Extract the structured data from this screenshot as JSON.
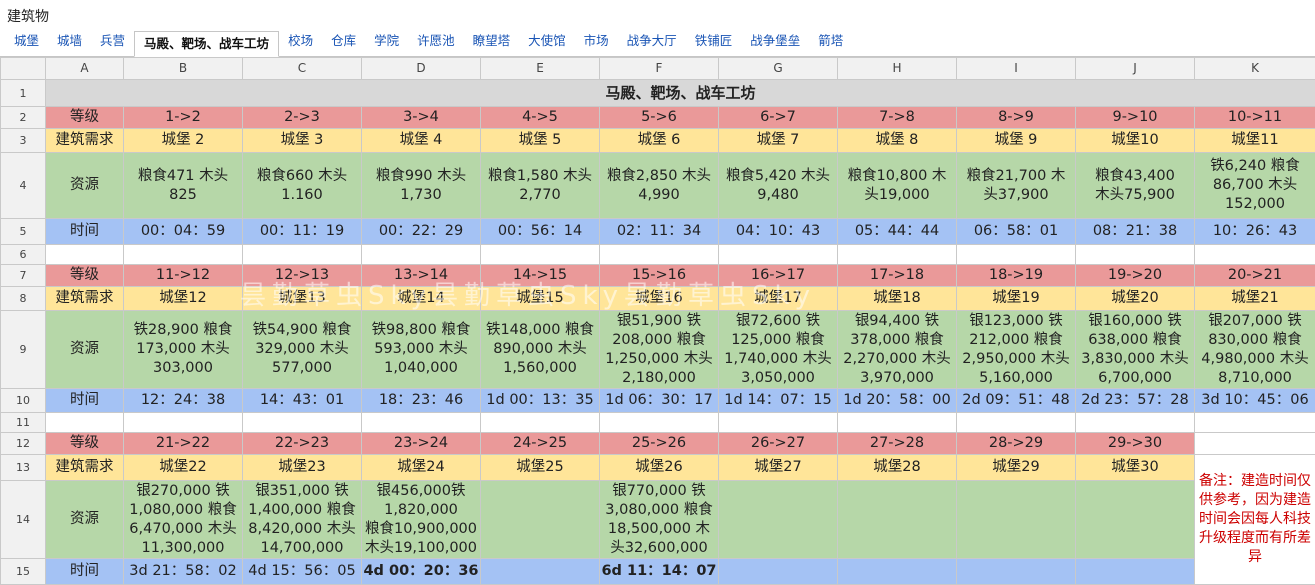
{
  "window": {
    "title": "建筑物"
  },
  "tabs": [
    {
      "label": "城堡"
    },
    {
      "label": "城墙"
    },
    {
      "label": "兵营"
    },
    {
      "label": "马殿、靶场、战车工坊",
      "active": true
    },
    {
      "label": "校场"
    },
    {
      "label": "仓库"
    },
    {
      "label": "学院"
    },
    {
      "label": "许愿池"
    },
    {
      "label": "瞭望塔"
    },
    {
      "label": "大使馆"
    },
    {
      "label": "市场"
    },
    {
      "label": "战争大厅"
    },
    {
      "label": "铁铺匠"
    },
    {
      "label": "战争堡垒"
    },
    {
      "label": "箭塔"
    }
  ],
  "columns": [
    "A",
    "B",
    "C",
    "D",
    "E",
    "F",
    "G",
    "H",
    "I",
    "J",
    "K"
  ],
  "row_numbers": [
    "1",
    "2",
    "3",
    "4",
    "5",
    "6",
    "7",
    "8",
    "9",
    "10",
    "11",
    "12",
    "13",
    "14",
    "15"
  ],
  "sheet_title": "马殿、靶场、战车工坊",
  "labels": {
    "level": "等级",
    "requirement": "建筑需求",
    "resource": "资源",
    "time": "时间"
  },
  "blocks": [
    {
      "levels": [
        "1->2",
        "2->3",
        "3->4",
        "4->5",
        "5->6",
        "6->7",
        "7->8",
        "8->9",
        "9->10",
        "10->11"
      ],
      "requirements": [
        "城堡 2",
        "城堡 3",
        "城堡 4",
        "城堡 5",
        "城堡 6",
        "城堡 7",
        "城堡 8",
        "城堡 9",
        "城堡10",
        "城堡11"
      ],
      "resources": [
        "粮食471 木头\n825",
        "粮食660 木头\n1.160",
        "粮食990 木头\n1,730",
        "粮食1,580 木头\n2,770",
        "粮食2,850 木头\n4,990",
        "粮食5,420 木头\n9,480",
        "粮食10,800 木\n头19,000",
        "粮食21,700 木\n头37,900",
        "粮食43,400\n木头75,900",
        "铁6,240 粮食\n86,700 木头\n152,000"
      ],
      "times": [
        "00：04：59",
        "00：11：19",
        "00：22：29",
        "00：56：14",
        "02：11：34",
        "04：10：43",
        "05：44：44",
        "06：58：01",
        "08：21：38",
        "10：26：43"
      ]
    },
    {
      "levels": [
        "11->12",
        "12->13",
        "13->14",
        "14->15",
        "15->16",
        "16->17",
        "17->18",
        "18->19",
        "19->20",
        "20->21"
      ],
      "requirements": [
        "城堡12",
        "城堡13",
        "城堡14",
        "城堡15",
        "城堡16",
        "城堡17",
        "城堡18",
        "城堡19",
        "城堡20",
        "城堡21"
      ],
      "resources": [
        "铁28,900 粮食\n173,000 木头\n303,000",
        "铁54,900 粮食\n329,000 木头\n577,000",
        "铁98,800 粮食\n593,000 木头\n1,040,000",
        "铁148,000 粮食\n890,000 木头\n1,560,000",
        "银51,900 铁\n208,000 粮食\n1,250,000 木头\n2,180,000",
        "银72,600 铁\n125,000 粮食\n1,740,000 木头\n3,050,000",
        "银94,400 铁\n378,000 粮食\n2,270,000 木头\n3,970,000",
        "银123,000 铁\n212,000 粮食\n2,950,000 木头\n5,160,000",
        "银160,000 铁\n638,000 粮食\n3,830,000 木头\n6,700,000",
        "银207,000 铁\n830,000 粮食\n4,980,000 木头\n8,710,000"
      ],
      "times": [
        "12：24：38",
        "14：43：01",
        "18：23：46",
        "1d 00：13：35",
        "1d 06：30：17",
        "1d 14：07：15",
        "1d 20：58：00",
        "2d 09：51：48",
        "2d 23：57：28",
        "3d 10：45：06"
      ]
    },
    {
      "levels": [
        "21->22",
        "22->23",
        "23->24",
        "24->25",
        "25->26",
        "26->27",
        "27->28",
        "28->29",
        "29->30"
      ],
      "requirements": [
        "城堡22",
        "城堡23",
        "城堡24",
        "城堡25",
        "城堡26",
        "城堡27",
        "城堡28",
        "城堡29",
        "城堡30"
      ],
      "resources": [
        "银270,000 铁\n1,080,000 粮食\n6,470,000 木头\n11,300,000",
        "银351,000 铁\n1,400,000 粮食\n8,420,000 木头\n14,700,000",
        "银456,000铁\n1,820,000\n粮食10,900,000\n木头19,100,000",
        "",
        "银770,000 铁\n3,080,000 粮食\n18,500,000 木\n头32,600,000",
        "",
        "",
        "",
        ""
      ],
      "times": [
        "3d 21：58：02",
        "4d 15：56：05",
        "4d 00：20：36",
        "",
        "6d 11：14：07",
        "",
        "",
        "",
        ""
      ]
    }
  ],
  "note": "备注：建造时间仅供参考，因为建造时间会因每人科技升级程度而有所差异",
  "watermark": "昙勤草虫Sky昙勤草虫Sky昙勤草虫Sky",
  "colors": {
    "level": "#ea9999",
    "requirement": "#ffe599",
    "resource": "#b6d7a8",
    "time": "#a4c2f4",
    "note": "#cc0000"
  }
}
